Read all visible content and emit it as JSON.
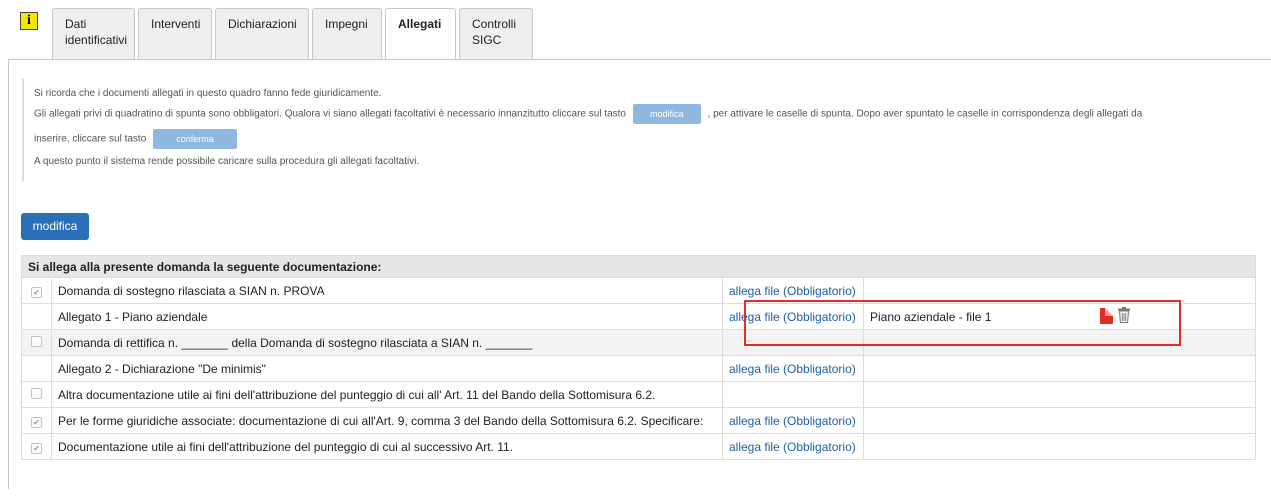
{
  "tabs": [
    {
      "label": "Dati\nidentificativi",
      "width": 83
    },
    {
      "label": "Interventi",
      "width": 74
    },
    {
      "label": "Dichiarazioni",
      "width": 94
    },
    {
      "label": "Impegni",
      "width": 70
    },
    {
      "label": "Allegati",
      "width": 71,
      "active": true
    },
    {
      "label": "Controlli\nSIGC",
      "width": 74
    }
  ],
  "info": {
    "line1": "Si ricorda che i documenti allegati in questo quadro fanno fede giuridicamente.",
    "line2a": "Gli allegati privi di quadratino di spunta sono obbligatori. Qualora vi siano allegati facoltativi è necessario innanzitutto cliccare sul tasto",
    "line2_btn": "modifica",
    "line2b": ", per attivare le caselle di spunta. Dopo aver spuntato le caselle in corrispondenza degli allegati da",
    "line3a": "inserire, cliccare sul tasto",
    "line3_btn": "conferma",
    "line4": "A questo punto il sistema rende possibile caricare sulla procedura gli allegati facoltativi."
  },
  "modifica_button": "modifica",
  "table": {
    "header": "Si allega alla presente domanda la seguente documentazione:",
    "rows": [
      {
        "checkbox": "checked",
        "desc": "Domanda di sostegno rilasciata a SIAN n. PROVA",
        "link": "allega file (Obbligatorio)",
        "file": "",
        "shade": false
      },
      {
        "checkbox": "none",
        "desc": "Allegato 1 - Piano aziendale",
        "link": "allega file (Obbligatorio)",
        "file": "Piano aziendale - file 1",
        "shade": false,
        "icons": true
      },
      {
        "checkbox": "empty",
        "desc": "Domanda di rettifica n. _______ della Domanda di sostegno rilasciata a SIAN n. _______",
        "link": "",
        "file": "",
        "shade": true
      },
      {
        "checkbox": "none",
        "desc": "Allegato 2 - Dichiarazione \"De minimis\"",
        "link": "allega file (Obbligatorio)",
        "file": "",
        "shade": false
      },
      {
        "checkbox": "empty",
        "desc": "Altra documentazione utile ai fini dell'attribuzione del punteggio di cui all' Art. 11 del Bando della Sottomisura 6.2.",
        "link": "",
        "file": "",
        "shade": false
      },
      {
        "checkbox": "checked",
        "desc": "Per le forme giuridiche associate: documentazione di cui all'Art. 9, comma 3 del Bando della Sottomisura 6.2. Specificare:",
        "link": "allega file (Obbligatorio)",
        "file": "",
        "shade": false
      },
      {
        "checkbox": "checked",
        "desc": "Documentazione utile ai fini dell'attribuzione del punteggio di cui al successivo Art. 11.",
        "link": "allega file (Obbligatorio)",
        "file": "",
        "shade": false
      }
    ]
  },
  "icons": {
    "info": "info-icon",
    "pdf": "pdf-icon",
    "trash": "trash-icon"
  },
  "colors": {
    "primary": "#2a70b8",
    "link": "#1f5fa8",
    "highlight": "#e52b2b"
  }
}
